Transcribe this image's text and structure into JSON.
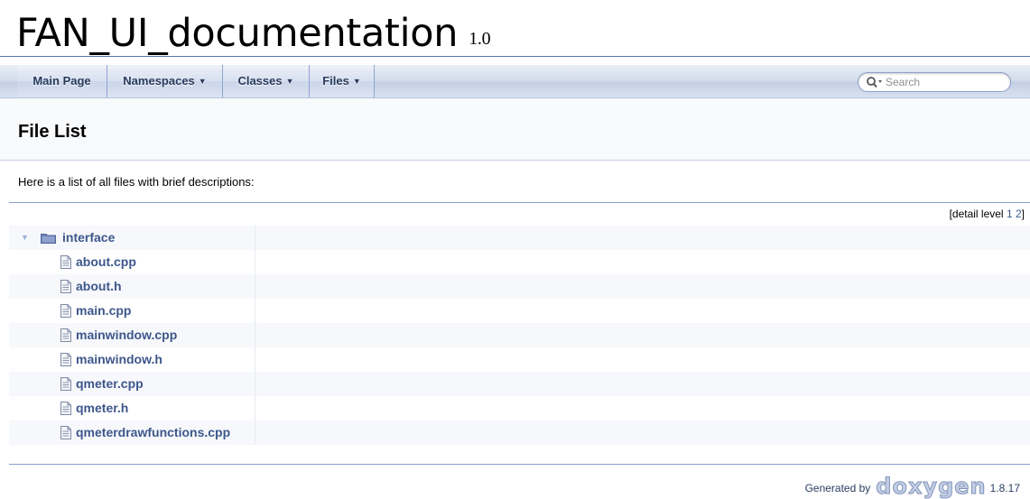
{
  "project": {
    "name": "FAN_UI_documentation",
    "number": "1.0"
  },
  "nav": {
    "items": [
      {
        "label": "Main Page",
        "dropdown": false
      },
      {
        "label": "Namespaces",
        "dropdown": true
      },
      {
        "label": "Classes",
        "dropdown": true
      },
      {
        "label": "Files",
        "dropdown": true
      }
    ],
    "caret": "▼",
    "search": {
      "placeholder": "Search",
      "icon": "search-icon"
    }
  },
  "page": {
    "title": "File List",
    "intro": "Here is a list of all files with brief descriptions:"
  },
  "detail_level": {
    "prefix": "[detail level ",
    "levels": [
      "1",
      "2"
    ],
    "suffix": "]"
  },
  "tree": {
    "folder": {
      "name": "interface",
      "expanded": true,
      "arrow": "▼",
      "icon": "folder-icon"
    },
    "files": [
      "about.cpp",
      "about.h",
      "main.cpp",
      "mainwindow.cpp",
      "mainwindow.h",
      "qmeter.cpp",
      "qmeter.h",
      "qmeterdrawfunctions.cpp"
    ],
    "file_icon": "file-icon"
  },
  "footer": {
    "generated_by": "Generated by",
    "tool": "doxygen",
    "version": "1.8.17"
  },
  "colors": {
    "link": "#3d578c",
    "nav_text": "#283A5D",
    "rule": "#879ECB"
  }
}
